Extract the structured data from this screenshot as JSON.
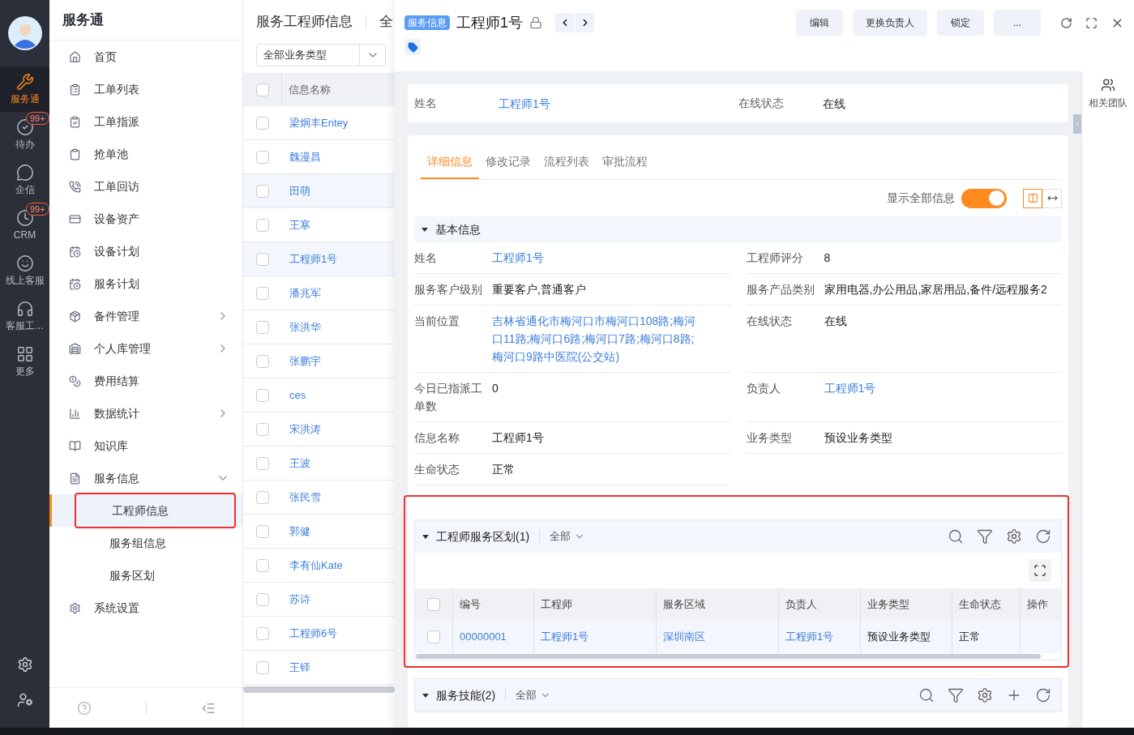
{
  "rail": {
    "items": [
      {
        "label": "服务通",
        "selected": true
      },
      {
        "label": "待办",
        "selected": false,
        "badge": "99+"
      },
      {
        "label": "企信",
        "selected": false
      },
      {
        "label": "CRM",
        "selected": false,
        "badge": "99+"
      },
      {
        "label": "线上客服",
        "selected": false
      },
      {
        "label": "客服工...",
        "selected": false
      },
      {
        "label": "更多",
        "selected": false
      }
    ]
  },
  "nav": {
    "title": "服务通",
    "items": [
      {
        "label": "首页"
      },
      {
        "label": "工单列表"
      },
      {
        "label": "工单指派"
      },
      {
        "label": "抢单池"
      },
      {
        "label": "工单回访"
      },
      {
        "label": "设备资产"
      },
      {
        "label": "设备计划"
      },
      {
        "label": "服务计划"
      },
      {
        "label": "备件管理",
        "expanded": false
      },
      {
        "label": "个人库管理",
        "expanded": false
      },
      {
        "label": "费用结算"
      },
      {
        "label": "数据统计",
        "expanded": false
      },
      {
        "label": "知识库"
      },
      {
        "label": "服务信息",
        "expanded": true,
        "children": [
          {
            "label": "工程师信息",
            "selected": true,
            "highlighted": true
          },
          {
            "label": "服务组信息",
            "selected": false,
            "highlighted": false
          },
          {
            "label": "服务区划",
            "selected": false,
            "highlighted": false
          }
        ]
      },
      {
        "label": "系统设置"
      }
    ]
  },
  "list": {
    "title": "服务工程师信息",
    "scope": "全",
    "filter": "全部业务类型",
    "column": "信息名称",
    "all_checked": false,
    "rows": [
      {
        "name": "梁炯丰Entey",
        "selected": false,
        "checked": false
      },
      {
        "name": "魏漫昌",
        "selected": false,
        "checked": false
      },
      {
        "name": "田萌",
        "selected": true,
        "checked": false
      },
      {
        "name": "王寒",
        "selected": false,
        "checked": false
      },
      {
        "name": "工程师1号",
        "selected": true,
        "checked": false
      },
      {
        "name": "潘兆军",
        "selected": false,
        "checked": false
      },
      {
        "name": "张洪华",
        "selected": false,
        "checked": false
      },
      {
        "name": "张鹏宇",
        "selected": false,
        "checked": false
      },
      {
        "name": "ces",
        "selected": false,
        "checked": false
      },
      {
        "name": "宋洪涛",
        "selected": false,
        "checked": false
      },
      {
        "name": "王波",
        "selected": false,
        "checked": false
      },
      {
        "name": "张民雪",
        "selected": false,
        "checked": false
      },
      {
        "name": "郭健",
        "selected": false,
        "checked": false
      },
      {
        "name": "李有仙Kate",
        "selected": false,
        "checked": false
      },
      {
        "name": "苏诗",
        "selected": false,
        "checked": false
      },
      {
        "name": "工程师6号",
        "selected": false,
        "checked": false
      },
      {
        "name": "王铎",
        "selected": false,
        "checked": false
      }
    ]
  },
  "detail": {
    "tag": "服务信息",
    "title": "工程师1号",
    "actions": [
      "编辑",
      "更换负责人",
      "锁定",
      "..."
    ],
    "summary": [
      {
        "label": "姓名",
        "value": "工程师1号",
        "link": true
      },
      {
        "label": "在线状态",
        "value": "在线",
        "link": false
      }
    ],
    "tabs": [
      {
        "label": "详细信息",
        "selected": true
      },
      {
        "label": "修改记录",
        "selected": false
      },
      {
        "label": "流程列表",
        "selected": false
      },
      {
        "label": "审批流程",
        "selected": false
      }
    ],
    "show_all": {
      "label": "显示全部信息",
      "on": true
    },
    "layout": [
      {
        "kind": "columns",
        "selected": true
      },
      {
        "kind": "wide",
        "selected": false
      }
    ],
    "section": {
      "title": "基本信息",
      "expanded": true,
      "rows": [
        {
          "cells": [
            {
              "label": "姓名",
              "value": "工程师1号",
              "link": true
            },
            {
              "label": "工程师评分",
              "value": "8",
              "link": false
            }
          ]
        },
        {
          "cells": [
            {
              "label": "服务客户级别",
              "value": "重要客户,普通客户",
              "link": false
            },
            {
              "label": "服务产品类别",
              "value": "家用电器,办公用品,家居用品,备件/远程服务2",
              "link": false
            }
          ]
        },
        {
          "cells": [
            {
              "label": "当前位置",
              "value": "吉林省通化市梅河口市梅河口108路;梅河口11路;梅河口6路;梅河口7路;梅河口8路;梅河口9路中医院(公交站)",
              "link": true
            },
            {
              "label": "在线状态",
              "value": "在线",
              "link": false
            }
          ]
        },
        {
          "cells": [
            {
              "label": "今日已指派工单数",
              "value": "0",
              "link": false
            },
            {
              "label": "负责人",
              "value": "工程师1号",
              "link": true
            }
          ]
        },
        {
          "cells": [
            {
              "label": "信息名称",
              "value": "工程师1号",
              "link": false
            },
            {
              "label": "业务类型",
              "value": "预设业务类型",
              "link": false
            }
          ]
        },
        {
          "cells": [
            {
              "label": "生命状态",
              "value": "正常",
              "link": false
            }
          ]
        }
      ]
    },
    "related": [
      {
        "title": "工程师服务区划(1)",
        "filter": "全部",
        "expanded": true,
        "highlighted": true,
        "all_checked": false,
        "columns": [
          "编号",
          "工程师",
          "服务区域",
          "负责人",
          "业务类型",
          "生命状态",
          "操作"
        ],
        "rows": [
          {
            "checked": false,
            "cells": [
              {
                "value": "00000001",
                "link": true
              },
              {
                "value": "工程师1号",
                "link": true
              },
              {
                "value": "深圳南区",
                "link": true
              },
              {
                "value": "工程师1号",
                "link": true
              },
              {
                "value": "预设业务类型",
                "link": false
              },
              {
                "value": "正常",
                "link": false
              }
            ]
          }
        ]
      },
      {
        "title": "服务技能(2)",
        "filter": "全部",
        "expanded": true
      }
    ],
    "side": {
      "label": "相关团队"
    }
  }
}
